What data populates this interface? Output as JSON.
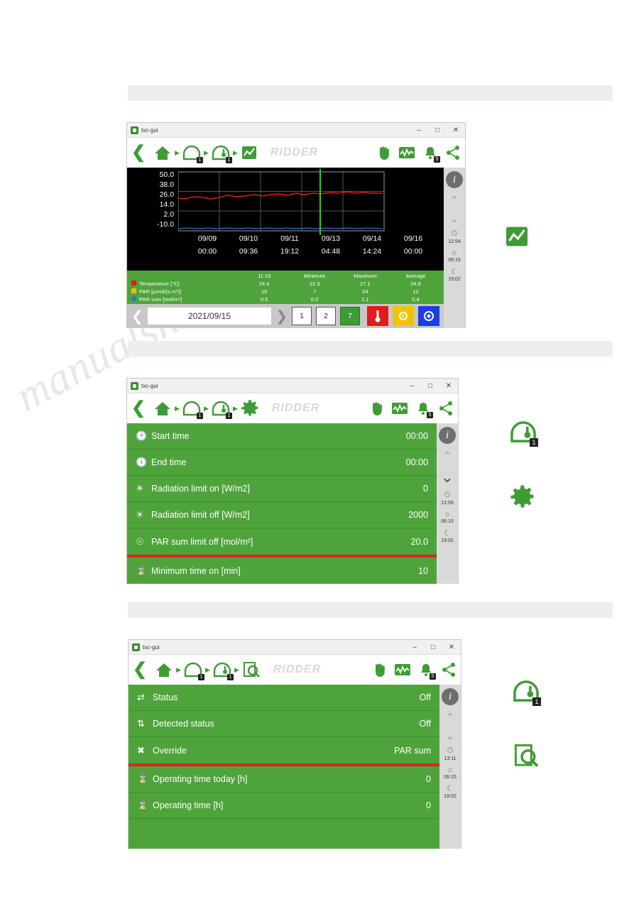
{
  "watermark": "manualshive.com",
  "window1": {
    "title": "txc-gui",
    "title_buttons": [
      "–",
      "□",
      "✕"
    ],
    "toolbar": {
      "back_icon": "chevron-left-icon",
      "home_icon": "home-icon",
      "greenhouse_icon": "greenhouse-icon",
      "greenhouse_badge": "1",
      "climate_icon": "greenhouse-thermometer-icon",
      "climate_badge": "1",
      "graph_icon": "graph-icon",
      "brand": "RIDDER",
      "hand_icon": "hand-icon",
      "chart_icon": "chart-icon",
      "alarm_icon": "alarm-bell-icon",
      "alarm_badge": "5",
      "share_icon": "share-icon"
    },
    "rail": {
      "info": "i",
      "up": "⌃",
      "down": "⌄",
      "time1": "12:54",
      "time2": "06:15",
      "time3": "19:02"
    },
    "chart_data": {
      "type": "line",
      "title": "",
      "ylabel": "",
      "xlabel": "",
      "yticks": [
        "50.0",
        "38.0",
        "26.0",
        "14.0",
        "2.0",
        "-10.0"
      ],
      "ylim": [
        -10.0,
        50.0
      ],
      "xticks_top": [
        "09/09",
        "09/10",
        "09/11",
        "09/13",
        "09/14",
        "09/16"
      ],
      "xticks_bottom": [
        "00:00",
        "09:36",
        "19:12",
        "04:48",
        "14:24",
        "00:00"
      ],
      "cursor_label": "11:15",
      "grid": true,
      "series": [
        {
          "name": "Temperature [°C]",
          "color": "#e01b1b",
          "marker": "thermometer",
          "value": "24.4",
          "min": "22.3",
          "max": "27.1",
          "avg": "24.8"
        },
        {
          "name": "PAR [µmol/(s.m²)]",
          "color": "#e8c200",
          "marker": "square",
          "value": "16",
          "min": "7",
          "max": "24",
          "avg": "12"
        },
        {
          "name": "PAR sum [mol/m²]",
          "color": "#2f6fd0",
          "marker": "circle",
          "value": "0.5",
          "min": "0.0",
          "max": "1.1",
          "avg": "0.4"
        }
      ],
      "legend_headers": [
        "",
        "11:15",
        "Minimum",
        "Maximum",
        "Average"
      ]
    },
    "datebar": {
      "prev_icon": "chevron-left-icon",
      "date": "2021/09/15",
      "next_icon": "chevron-right-icon",
      "day_buttons": [
        "1",
        "2",
        "7"
      ],
      "active_day": "7",
      "temp_icon": "thermometer-icon",
      "par_icon": "sun-icon",
      "parsum_icon": "target-icon"
    }
  },
  "window2": {
    "title": "txc-gui",
    "title_buttons": [
      "–",
      "□",
      "✕"
    ],
    "toolbar": {
      "brand": "RIDDER",
      "alarm_badge": "5",
      "greenhouse_badge": "1",
      "climate_badge": "1",
      "settings_icon": "gear-icon"
    },
    "rail": {
      "info": "i",
      "time1": "12:59",
      "time2": "06:15",
      "time3": "19:02"
    },
    "rows": [
      {
        "icon": "clock-start-icon",
        "label": "Start time",
        "value": "00:00"
      },
      {
        "icon": "clock-end-icon",
        "label": "End time",
        "value": "00:00"
      },
      {
        "icon": "sun-icon",
        "label": "Radiation limit on [W/m2]",
        "value": "0"
      },
      {
        "icon": "sun-icon",
        "label": "Radiation limit off [W/m2]",
        "value": "2000"
      },
      {
        "icon": "target-icon",
        "label": "PAR sum limit off [mol/m²]",
        "value": "20.0"
      },
      {
        "icon": "hourglass-icon",
        "label": "Minimum time on [min]",
        "value": "10"
      }
    ],
    "selected_row_index": 4
  },
  "window3": {
    "title": "txc-gui",
    "title_buttons": [
      "–",
      "□",
      "✕"
    ],
    "toolbar": {
      "brand": "RIDDER",
      "alarm_badge": "5",
      "greenhouse_badge": "1",
      "climate_badge": "1",
      "inspect_icon": "magnifier-document-icon"
    },
    "rail": {
      "info": "i",
      "time1": "13:11",
      "time2": "06:15",
      "time3": "19:02"
    },
    "rows": [
      {
        "icon": "status-icon",
        "label": "Status",
        "value": "Off"
      },
      {
        "icon": "detected-status-icon",
        "label": "Detected status",
        "value": "Off"
      },
      {
        "icon": "override-icon",
        "label": "Override",
        "value": "PAR sum"
      },
      {
        "icon": "hourglass-icon",
        "label": "Operating time today [h]",
        "value": "0"
      },
      {
        "icon": "hourglass-icon",
        "label": "Operating time [h]",
        "value": "0"
      }
    ],
    "selected_row_index": 2
  },
  "annotations": {
    "a1": "graph-icon",
    "a2": "greenhouse-thermometer-icon",
    "a2_badge": "1",
    "a3": "gear-icon",
    "a4": "greenhouse-thermometer-icon",
    "a4_badge": "1",
    "a5": "magnifier-document-icon"
  }
}
